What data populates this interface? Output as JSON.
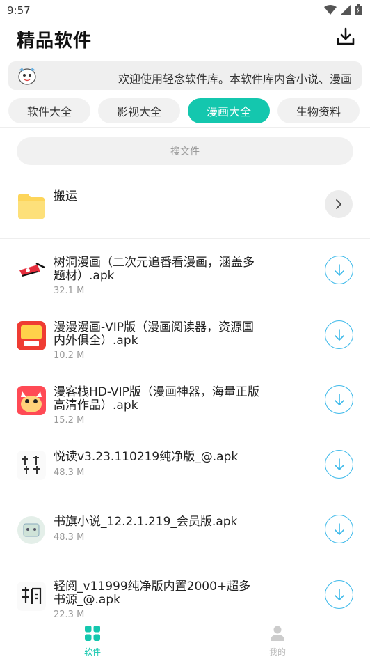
{
  "status_bar": {
    "time": "9:57"
  },
  "header": {
    "title": "精品软件",
    "download_icon": "download-icon"
  },
  "notice": {
    "text": "欢迎使用轻念软件库。本软件库内含小说、漫画"
  },
  "tabs": [
    {
      "label": "软件大全",
      "active": false
    },
    {
      "label": "影视大全",
      "active": false
    },
    {
      "label": "漫画大全",
      "active": true
    },
    {
      "label": "生物资料",
      "active": false
    }
  ],
  "search": {
    "placeholder": "搜文件"
  },
  "folder": {
    "name": "搬运",
    "icon": "folder-icon"
  },
  "files": [
    {
      "title": "树洞漫画（二次元追番看漫画，涵盖多题材）.apk",
      "size": "32.1 M",
      "icon": "shudong-app-icon"
    },
    {
      "title": "漫漫漫画-VIP版（漫画阅读器，资源国内外俱全）.apk",
      "size": "10.2 M",
      "icon": "manman-app-icon"
    },
    {
      "title": "漫客栈HD-VIP版（漫画神器，海量正版高清作品）.apk",
      "size": "15.2 M",
      "icon": "mankezhan-app-icon"
    },
    {
      "title": "悦读v3.23.110219纯净版_@.apk",
      "size": "48.3 M",
      "icon": "yuedu-app-icon"
    },
    {
      "title": "书旗小说_12.2.1.219_会员版.apk",
      "size": "48.3 M",
      "icon": "shuqi-app-icon"
    },
    {
      "title": "轻阅_v11999纯净版内置2000+超多书源_@.apk",
      "size": "22.3 M",
      "icon": "qingyue-app-icon"
    }
  ],
  "bottom_nav": [
    {
      "label": "软件",
      "icon": "grid-icon",
      "active": true
    },
    {
      "label": "我的",
      "icon": "person-icon",
      "active": false
    }
  ],
  "colors": {
    "accent": "#14c7ae",
    "download_blue": "#3cb9ea",
    "folder_yellow": "#fdd55a"
  }
}
